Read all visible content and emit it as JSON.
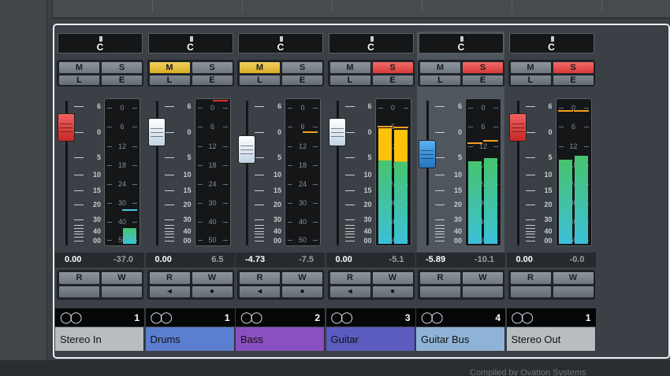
{
  "scale_labels": [
    "6",
    "0",
    "5",
    "10",
    "15",
    "20",
    "30",
    "40",
    "00"
  ],
  "meter_labels": [
    "0",
    "6",
    "12",
    "18",
    "24",
    "30",
    "40",
    "50"
  ],
  "strips": [
    {
      "pan": "C",
      "m": "M",
      "s": "S",
      "l": "L",
      "e": "E",
      "mute": false,
      "solo": false,
      "fader_db": 1.5,
      "cap": "red",
      "level_a": 0.0,
      "level_b": 0.11,
      "peak_a": 0.0,
      "peak_b": 0.23,
      "peak_color": "#49c7e0",
      "value1": "0.00",
      "value2": "-37.0",
      "r": "R",
      "w": "W",
      "second_row": false,
      "num": "1",
      "name": "Stereo In",
      "name_color": "#b9bdc1",
      "selected": false
    },
    {
      "pan": "C",
      "m": "M",
      "s": "S",
      "l": "L",
      "e": "E",
      "mute": true,
      "solo": false,
      "fader_db": 0.0,
      "cap": "white",
      "level_a": 0.0,
      "level_b": 0.0,
      "peak_a": 0.0,
      "peak_b": 1.0,
      "peak_color": "#e0302c",
      "value1": "0.00",
      "value2": "6.5",
      "r": "R",
      "w": "W",
      "second_row": true,
      "num": "1",
      "name": "Drums",
      "name_color": "#5b7ed0",
      "selected": false
    },
    {
      "pan": "C",
      "m": "M",
      "s": "S",
      "l": "L",
      "e": "E",
      "mute": true,
      "solo": false,
      "fader_db": -4.73,
      "cap": "white",
      "level_a": 0.0,
      "level_b": 0.0,
      "peak_a": 0.0,
      "peak_b": 0.78,
      "peak_color": "#f0a020",
      "value1": "-4.73",
      "value2": "-7.5",
      "r": "R",
      "w": "W",
      "second_row": true,
      "num": "2",
      "name": "Bass",
      "name_color": "#8a4fc0",
      "selected": false
    },
    {
      "pan": "C",
      "m": "M",
      "s": "S",
      "l": "L",
      "e": "E",
      "mute": false,
      "solo": true,
      "fader_db": 0.0,
      "cap": "white",
      "level_a": 0.8,
      "level_b": 0.79,
      "peak_a": 0.82,
      "peak_b": 0.81,
      "peak_color": "#f0a020",
      "value1": "0.00",
      "value2": "-5.1",
      "r": "R",
      "w": "W",
      "second_row": true,
      "num": "3",
      "name": "Guitar",
      "name_color": "#5b5bc0",
      "selected": false
    },
    {
      "pan": "C",
      "m": "M",
      "s": "S",
      "l": "L",
      "e": "E",
      "mute": false,
      "solo": true,
      "fader_db": -5.89,
      "cap": "blue",
      "level_a": 0.57,
      "level_b": 0.59,
      "peak_a": 0.7,
      "peak_b": 0.72,
      "peak_color": "#f0a020",
      "value1": "-5.89",
      "value2": "-10.1",
      "r": "R",
      "w": "W",
      "second_row": false,
      "num": "4",
      "name": "Guitar Bus",
      "name_color": "#8fb3d6",
      "selected": true
    },
    {
      "pan": "C",
      "m": "M",
      "s": "S",
      "l": "L",
      "e": "E",
      "mute": false,
      "solo": true,
      "fader_db": 1.5,
      "cap": "red",
      "level_a": 0.58,
      "level_b": 0.61,
      "peak_a": 0.93,
      "peak_b": 0.93,
      "peak_color": "#f0a020",
      "value1": "0.00",
      "value2": "-0.0",
      "r": "R",
      "w": "W",
      "second_row": false,
      "num": "1",
      "name": "Stereo Out",
      "name_color": "#b9bdc1",
      "selected": false
    }
  ],
  "status_text": "Compiled by Ovation Systems"
}
